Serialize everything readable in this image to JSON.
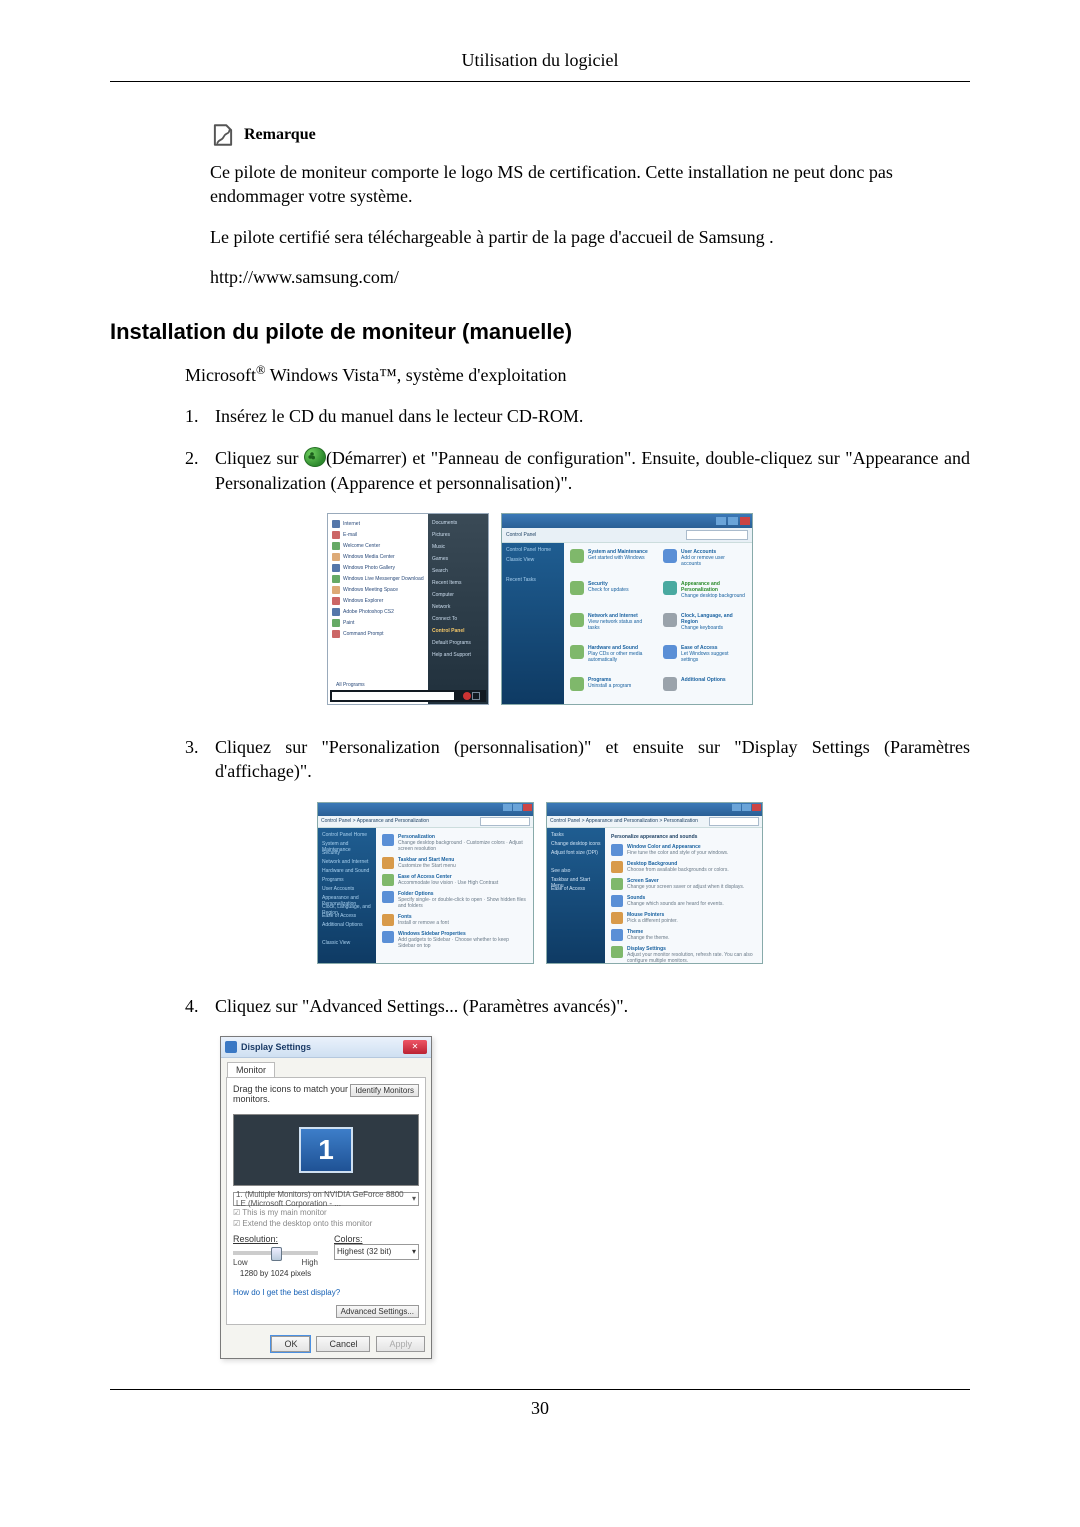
{
  "page": {
    "header": "Utilisation du logiciel",
    "number": "30"
  },
  "note": {
    "label": "Remarque",
    "p1": "Ce pilote de moniteur comporte le logo MS de certification. Cette installation ne peut donc pas endommager votre système.",
    "p2": "Le pilote certifié sera téléchargeable à partir de la page d'accueil de Samsung .",
    "url": "http://www.samsung.com/"
  },
  "section": {
    "title": "Installation du pilote de moniteur (manuelle)",
    "os_prefix": "Microsoft",
    "os_mid": " Windows Vista™, ",
    "os_suffix": "système d'exploitation"
  },
  "steps": {
    "s1": {
      "num": "1.",
      "text": "Insérez le CD du manuel dans le lecteur CD-ROM."
    },
    "s2": {
      "num": "2.",
      "pre": "Cliquez sur ",
      "post": "(Démarrer) et \"Panneau de configuration\". Ensuite, double-cliquez sur \"Appearance and Personalization (Apparence et personnalisation)\"."
    },
    "s3": {
      "num": "3.",
      "text": "Cliquez sur \"Personalization (personnalisation)\" et ensuite sur \"Display Settings (Paramètres d'affichage)\"."
    },
    "s4": {
      "num": "4.",
      "text": "Cliquez sur \"Advanced Settings... (Paramètres avancés)\"."
    }
  },
  "startmenu": {
    "items": [
      "Internet",
      "E-mail",
      "Welcome Center",
      "Windows Media Center",
      "Windows Photo Gallery",
      "Windows Live Messenger Download",
      "Windows Meeting Space",
      "Windows Explorer",
      "Adobe Photoshop CS2",
      "Paint",
      "Command Prompt"
    ],
    "all_programs": "All Programs",
    "right": [
      "Documents",
      "Pictures",
      "Music",
      "Games",
      "Search",
      "Recent Items",
      "Computer",
      "Network",
      "Connect To",
      "Control Panel",
      "Default Programs",
      "Help and Support"
    ],
    "highlight": "Control Panel"
  },
  "cpanel": {
    "breadcrumb": "Control Panel",
    "side": [
      "Control Panel Home",
      "Classic View",
      "",
      "Recent Tasks"
    ],
    "cats": [
      {
        "t": "System and Maintenance",
        "s": "Get started with Windows"
      },
      {
        "t": "User Accounts",
        "s": "Add or remove user accounts"
      },
      {
        "t": "Security",
        "s": "Check for updates"
      },
      {
        "t": "Appearance and Personalization",
        "s": "Change desktop background",
        "hi": true
      },
      {
        "t": "Network and Internet",
        "s": "View network status and tasks"
      },
      {
        "t": "Clock, Language, and Region",
        "s": "Change keyboards"
      },
      {
        "t": "Hardware and Sound",
        "s": "Play CDs or other media automatically"
      },
      {
        "t": "Ease of Access",
        "s": "Let Windows suggest settings"
      },
      {
        "t": "Programs",
        "s": "Uninstall a program"
      },
      {
        "t": "Additional Options",
        "s": ""
      }
    ]
  },
  "pers1": {
    "breadcrumb": "Control Panel > Appearance and Personalization",
    "side": [
      "Control Panel Home",
      "System and Maintenance",
      "Security",
      "Network and Internet",
      "Hardware and Sound",
      "Programs",
      "User Accounts",
      "Appearance and Personalization",
      "Clock, Language, and Region",
      "Ease of Access",
      "Additional Options",
      "",
      "Classic View"
    ],
    "entries": [
      {
        "t": "Personalization",
        "s": "Change desktop background · Customize colors · Adjust screen resolution"
      },
      {
        "t": "Taskbar and Start Menu",
        "s": "Customize the Start menu"
      },
      {
        "t": "Ease of Access Center",
        "s": "Accommodate low vision · Use High Contrast"
      },
      {
        "t": "Folder Options",
        "s": "Specify single- or double-click to open · Show hidden files and folders"
      },
      {
        "t": "Fonts",
        "s": "Install or remove a font"
      },
      {
        "t": "Windows Sidebar Properties",
        "s": "Add gadgets to Sidebar · Choose whether to keep Sidebar on top"
      }
    ]
  },
  "pers2": {
    "breadcrumb": "Control Panel > Appearance and Personalization > Personalization",
    "side": [
      "Tasks",
      "Change desktop icons",
      "Adjust font size (DPI)",
      "",
      "See also",
      "Taskbar and Start Menu",
      "Ease of Access"
    ],
    "heading": "Personalize appearance and sounds",
    "entries": [
      {
        "t": "Window Color and Appearance",
        "s": "Fine tune the color and style of your windows."
      },
      {
        "t": "Desktop Background",
        "s": "Choose from available backgrounds or colors."
      },
      {
        "t": "Screen Saver",
        "s": "Change your screen saver or adjust when it displays."
      },
      {
        "t": "Sounds",
        "s": "Change which sounds are heard for events."
      },
      {
        "t": "Mouse Pointers",
        "s": "Pick a different pointer."
      },
      {
        "t": "Theme",
        "s": "Change the theme."
      },
      {
        "t": "Display Settings",
        "s": "Adjust your monitor resolution, refresh rate. You can also configure multiple monitors."
      }
    ]
  },
  "display": {
    "title": "Display Settings",
    "tab": "Monitor",
    "hint": "Drag the icons to match your monitors.",
    "identify": "Identify Monitors",
    "monnum": "1",
    "combo": "1. (Multiple Monitors) on NVIDIA GeForce 8800 LE (Microsoft Corporation - ...",
    "chk1": "This is my main monitor",
    "chk2": "Extend the desktop onto this monitor",
    "res_label": "Resolution:",
    "low": "Low",
    "high": "High",
    "res_value": "1280 by 1024 pixels",
    "col_label": "Colors:",
    "col_value": "Highest (32 bit)",
    "help": "How do I get the best display?",
    "adv": "Advanced Settings...",
    "ok": "OK",
    "cancel": "Cancel",
    "apply": "Apply"
  }
}
